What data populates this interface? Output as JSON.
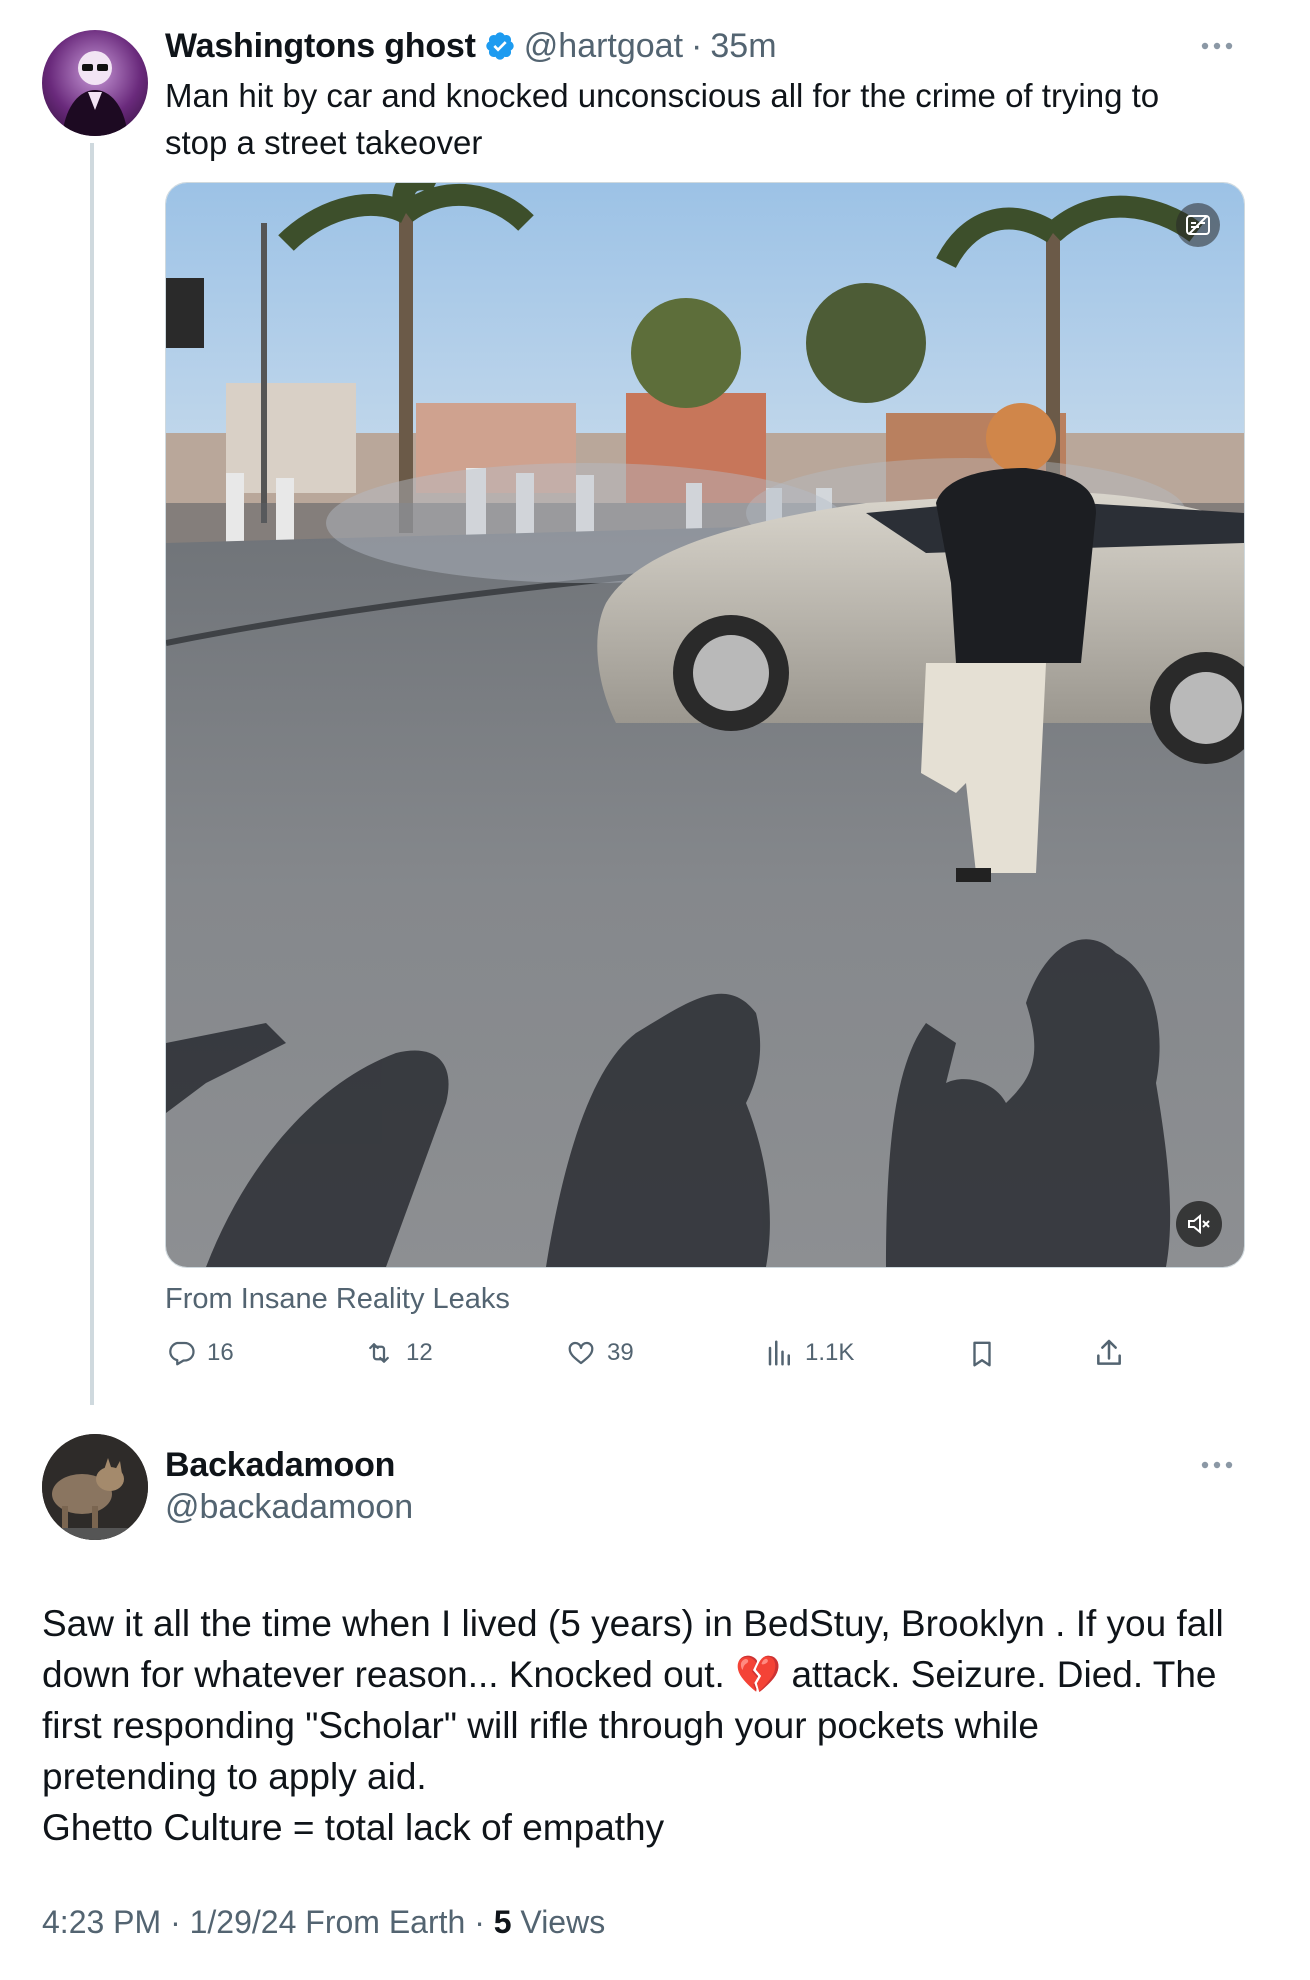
{
  "parent_tweet": {
    "author_name": "Washingtons ghost",
    "handle": "@hartgoat",
    "separator": "·",
    "time": "35m",
    "text": "Man hit by car and knocked unconscious all for the crime of trying to stop a street takeover",
    "more_icon": "more-horizontal-icon",
    "verified_icon": "verified-badge-icon",
    "media_source": "From Insane Reality Leaks",
    "actions": {
      "replies": "16",
      "reposts": "12",
      "likes": "39",
      "views": "1.1K"
    },
    "colors": {
      "verified": "#1d9bf0",
      "secondary_text": "#536471",
      "thread_line": "#cfd9de"
    }
  },
  "reply_tweet": {
    "author_name": "Backadamoon",
    "handle": "@backadamoon",
    "more_icon": "more-horizontal-icon",
    "text_lines": [
      "Saw it all the time when I lived (5 years) in BedStuy, Brooklyn . If you fall",
      "down for whatever reason... Knocked out. 💔 attack. Seizure. Died. The",
      "first responding \"Scholar\" will rifle through your pockets while",
      "pretending to apply aid.",
      "Ghetto Culture = total lack of empathy"
    ],
    "footer": {
      "time": "4:23 PM",
      "date": "1/29/24",
      "client": "From Earth",
      "views_count": "5",
      "views_label": "Views",
      "separator": "·"
    }
  }
}
